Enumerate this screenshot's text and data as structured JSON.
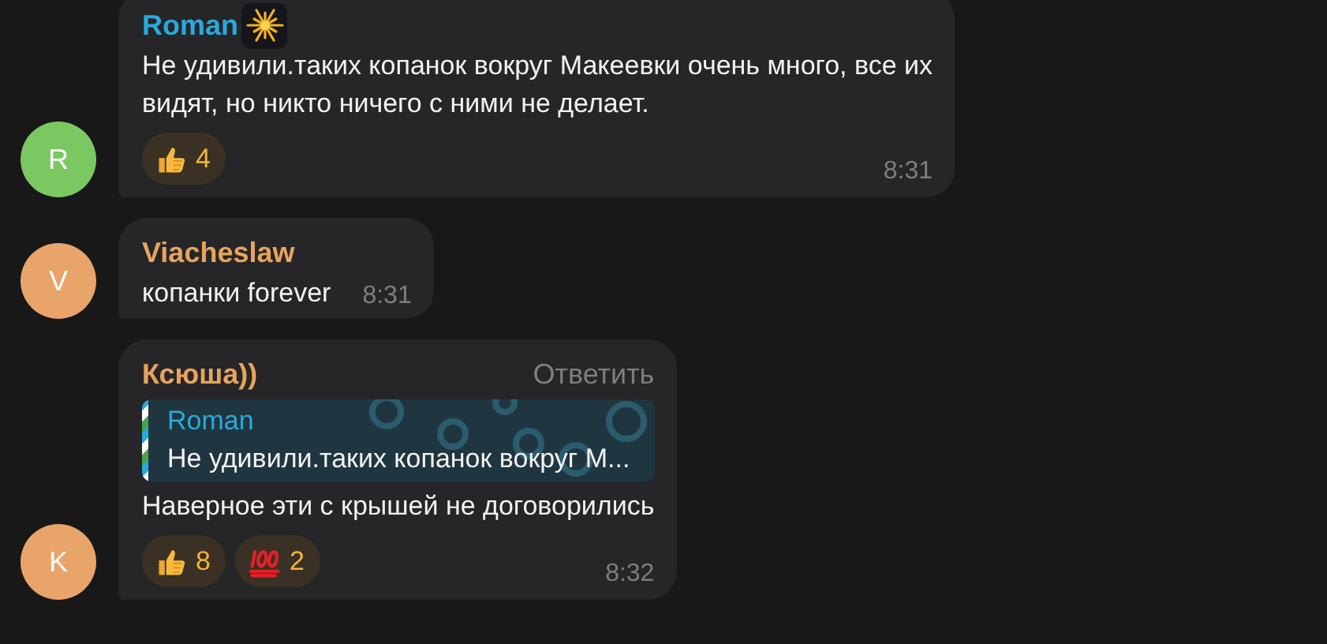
{
  "messages": [
    {
      "avatar": {
        "letter": "R",
        "color": "#7bc862"
      },
      "author": {
        "name": "Roman",
        "color": "#2aa9dc"
      },
      "author_badge": true,
      "text_lines": [
        "Не удивили.таких копанок вокруг Макеевки очень много, все их",
        "видят, но никто ничего с ними не делает."
      ],
      "reactions": [
        {
          "kind": "thumbs-up",
          "count": "4"
        }
      ],
      "time": "8:31"
    },
    {
      "avatar": {
        "letter": "V",
        "color": "#e9a46a"
      },
      "author": {
        "name": "Viacheslaw",
        "color": "#e8a45c"
      },
      "author_badge": false,
      "text_lines": [
        "копанки forever"
      ],
      "time": "8:31"
    },
    {
      "avatar": {
        "letter": "K",
        "color": "#e9a46a"
      },
      "author": {
        "name": "Ксюша))",
        "color": "#e8a45c"
      },
      "author_badge": false,
      "reply_action": "Ответить",
      "quote": {
        "author": "Roman",
        "text": "Не удивили.таких копанок вокруг М..."
      },
      "text_lines": [
        "Наверное эти с крышей не договорились"
      ],
      "reactions": [
        {
          "kind": "thumbs-up",
          "count": "8"
        },
        {
          "kind": "hundred",
          "count": "2"
        }
      ],
      "time": "8:32"
    }
  ]
}
